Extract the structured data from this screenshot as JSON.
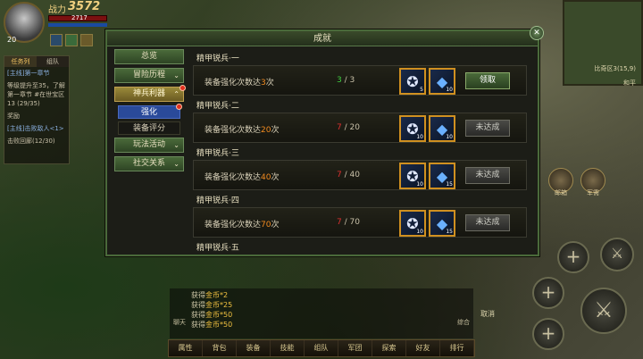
{
  "hud": {
    "power_label": "战力",
    "power_value": "3572",
    "hp_text": "2717",
    "level": "20"
  },
  "quest_panel": {
    "tabs": [
      "任务列",
      "组队"
    ],
    "lines": [
      "[主线]第一章节",
      "等级提升至35，了解第一章节 #在世宝区13 (29/35)",
      "奖励",
      "[主线]击败敌人<1>",
      "击败回廊(12/30)"
    ]
  },
  "minimap": {
    "zone": "比奇区3(15,9)",
    "label": "和平"
  },
  "window": {
    "title": "成就",
    "close": "✕"
  },
  "menu": {
    "items": [
      {
        "label": "总览",
        "arrow": ""
      },
      {
        "label": "冒险历程",
        "arrow": "⌄"
      },
      {
        "label": "神兵利器",
        "arrow": "⌃"
      }
    ],
    "sub": [
      {
        "label": "强化"
      },
      {
        "label": "装备评分"
      }
    ],
    "after": [
      {
        "label": "玩法活动",
        "arrow": "⌄"
      },
      {
        "label": "社交关系",
        "arrow": "⌄"
      }
    ]
  },
  "achievements": [
    {
      "title": "精甲锐兵·一",
      "desc_pre": "装备强化次数达",
      "desc_num": "3",
      "desc_post": "次",
      "cur": "3",
      "total": "/ 3",
      "done": true,
      "r1": "5",
      "r2": "10",
      "btn": "领取"
    },
    {
      "title": "精甲锐兵·二",
      "desc_pre": "装备强化次数达",
      "desc_num": "20",
      "desc_post": "次",
      "cur": "7",
      "total": "/ 20",
      "done": false,
      "r1": "10",
      "r2": "10",
      "btn": "未达成"
    },
    {
      "title": "精甲锐兵·三",
      "desc_pre": "装备强化次数达",
      "desc_num": "40",
      "desc_post": "次",
      "cur": "7",
      "total": "/ 40",
      "done": false,
      "r1": "10",
      "r2": "15",
      "btn": "未达成"
    },
    {
      "title": "精甲锐兵·四",
      "desc_pre": "装备强化次数达",
      "desc_num": "70",
      "desc_post": "次",
      "cur": "7",
      "total": "/ 70",
      "done": false,
      "r1": "10",
      "r2": "15",
      "btn": "未达成"
    }
  ],
  "next_section": "精甲锐兵·五",
  "chat": {
    "lines": [
      {
        "pre": "获得",
        "gold": "金币*2"
      },
      {
        "pre": "获得",
        "gold": "金币*25"
      },
      {
        "pre": "获得",
        "gold": "金币*50"
      },
      {
        "pre": "获得",
        "gold": "金币*50"
      }
    ],
    "left_label": "聊天",
    "right_label": "综合"
  },
  "bottom_bar": [
    "属性",
    "背包",
    "装备",
    "技能",
    "组队",
    "军团",
    "探索",
    "好友",
    "排行"
  ],
  "side": {
    "mail": "邮箱",
    "army": "军需",
    "cancel": "取消",
    "collect": "领取"
  }
}
